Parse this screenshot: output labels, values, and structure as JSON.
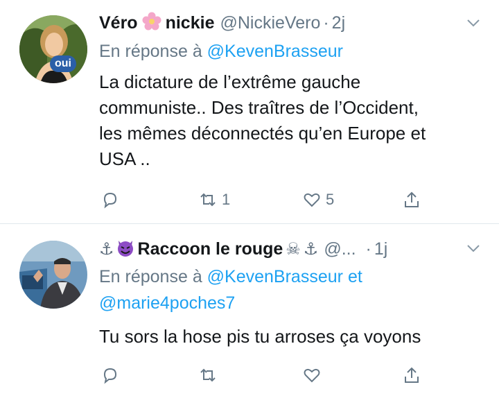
{
  "tweets": [
    {
      "display_name_a": "Véro",
      "display_name_b": "nickie",
      "name_emoji": "🌸",
      "avatar_badge": "oui",
      "handle": "@NickieVero",
      "separator": "·",
      "time": "2j",
      "reply_prefix": "En réponse à",
      "reply_mentions": [
        "@KevenBrasseur"
      ],
      "body_lines": [
        "La dictature de l’extrême gauche",
        "communiste.. Des traîtres de l’Occident,",
        "les mêmes déconnectés qu’en Europe et",
        "USA .."
      ],
      "actions": {
        "reply_count": "",
        "retweet_count": "1",
        "like_count": "5"
      }
    },
    {
      "display_name": "Raccoon le rouge",
      "name_prefix_emojis": [
        "⚓",
        "😈"
      ],
      "name_suffix_emojis": [
        "☠",
        "⚓"
      ],
      "handle": "@...",
      "separator": "·",
      "time": "1j",
      "reply_prefix": "En réponse à",
      "reply_mentions": [
        "@KevenBrasseur",
        "@marie4poches7"
      ],
      "reply_joiner": "et",
      "body_lines": [
        "Tu sors la hose pis tu arroses ça voyons"
      ],
      "actions": {
        "reply_count": "",
        "retweet_count": "",
        "like_count": ""
      }
    }
  ],
  "icons": {
    "reply": "reply-icon",
    "retweet": "retweet-icon",
    "like": "heart-icon",
    "share": "share-icon",
    "more": "chevron-down-icon"
  },
  "colors": {
    "text": "#14171a",
    "secondary": "#657786",
    "mention": "#1da1f2",
    "divider": "#e1e8ed"
  }
}
